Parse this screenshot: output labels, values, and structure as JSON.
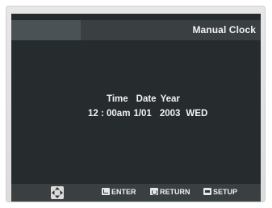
{
  "header": {
    "title": "Manual Clock"
  },
  "clock": {
    "labels": {
      "time": "Time",
      "date": "Date",
      "year": "Year"
    },
    "values": {
      "time": "12 : 00am",
      "date": "1/01",
      "year": "2003",
      "weekday": "WED"
    }
  },
  "footer": {
    "nav_icon": "four-direction-arrows-icon",
    "enter_label": "ENTER",
    "return_label": "RETURN",
    "setup_label": "SETUP"
  },
  "colors": {
    "screen_bg": "#262b2e",
    "bar_bg": "#3a3f42",
    "text": "#f2f2f2"
  }
}
